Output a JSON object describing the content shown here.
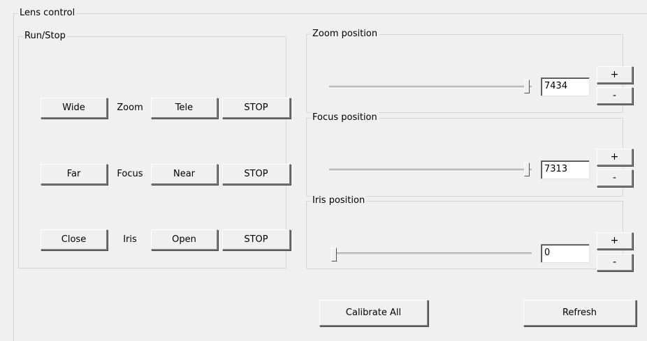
{
  "lens_control": {
    "title": "Lens control",
    "run_stop": {
      "title": "Run/Stop",
      "rows": [
        {
          "minus_label": "Wide",
          "name": "Zoom",
          "plus_label": "Tele",
          "stop_label": "STOP"
        },
        {
          "minus_label": "Far",
          "name": "Focus",
          "plus_label": "Near",
          "stop_label": "STOP"
        },
        {
          "minus_label": "Close",
          "name": "Iris",
          "plus_label": "Open",
          "stop_label": "STOP"
        }
      ]
    },
    "zoom_position": {
      "title": "Zoom position",
      "value": "7434",
      "level": 1.0,
      "plus_label": "+",
      "minus_label": "-"
    },
    "focus_position": {
      "title": "Focus position",
      "value": "7313",
      "level": 1.0,
      "plus_label": "+",
      "minus_label": "-"
    },
    "iris_position": {
      "title": "Iris position",
      "value": "0",
      "level": 0.0,
      "plus_label": "+",
      "minus_label": "-"
    },
    "calibrate_all_label": "Calibrate All",
    "refresh_label": "Refresh"
  }
}
